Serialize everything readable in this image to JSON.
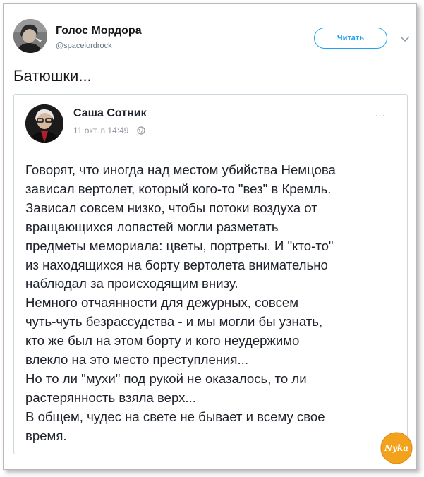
{
  "tweet": {
    "author_name": "Голос Мордора",
    "handle": "@spacelordrock",
    "follow_label": "Читать",
    "text": "Батюшки..."
  },
  "quoted_post": {
    "author_name": "Саша Сотник",
    "timestamp": "11 окт. в 14:49",
    "separator": "·",
    "more_label": "...",
    "lines": [
      "Говорят, что иногда над местом убийства Немцова",
      "зависал вертолет, который кого-то \"вез\" в Кремль.",
      "Зависал совсем низко, чтобы потоки воздуха от",
      "вращающихся лопастей могли разметать",
      "предметы мемориала: цветы, портреты. И \"кто-то\"",
      "из находящихся на борту вертолета внимательно",
      "наблюдал за происходящим внизу.",
      "Немного отчаянности для дежурных, совсем",
      "чуть-чуть безрассудства - и мы могли бы узнать,",
      "кто же был на этом борту и кого неудержимо",
      "влекло на это место преступления...",
      "Но то ли \"мухи\" под рукой не оказалось, то ли",
      "растерянность взяла верх...",
      "В общем, чудес на свете не бывает и всему свое",
      "время."
    ]
  },
  "watermark": {
    "text": "Nyka",
    "color": "#f3a21b"
  },
  "colors": {
    "accent": "#1da1f2",
    "text": "#14171a",
    "secondary": "#657786"
  },
  "icons": {
    "chevron": "chevron-down-icon",
    "globe": "globe-icon"
  }
}
